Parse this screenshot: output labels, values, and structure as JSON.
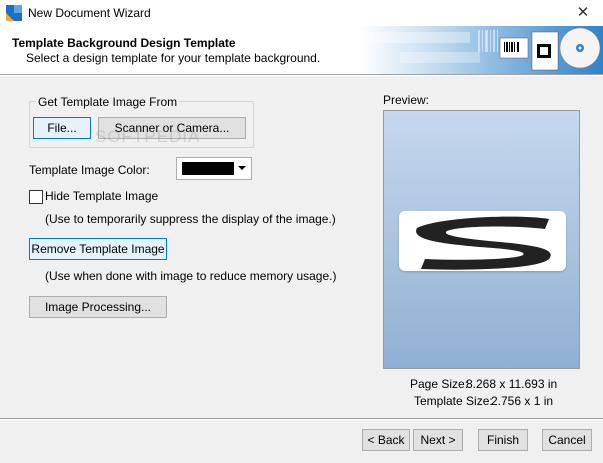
{
  "window": {
    "title": "New Document Wizard",
    "close_glyph": "✕"
  },
  "header": {
    "title": "Template Background Design Template",
    "subtitle": "Select a design template for your template background."
  },
  "left": {
    "group_label": "Get Template Image From",
    "file_button": "File...",
    "scanner_button": "Scanner or Camera...",
    "color_label": "Template Image Color:",
    "color_value": "#000000",
    "hide_label": "Hide Template Image",
    "hide_checked": false,
    "hide_note": "(Use to temporarily suppress the display of the image.)",
    "remove_button": "Remove Template Image",
    "remove_note": "(Use when done with image to reduce memory usage.)",
    "processing_button": "Image Processing..."
  },
  "preview": {
    "label": "Preview:",
    "page_size_label": "Page Size:",
    "page_size_value": "8.268 x 11.693 in",
    "template_size_label": "Template Size:",
    "template_size_value": "2.756 x 1 in"
  },
  "footer": {
    "back": "< Back",
    "next": "Next >",
    "finish": "Finish",
    "cancel": "Cancel"
  },
  "watermark": "SOFTPEDIA",
  "colors": {
    "accent": "#0078d7",
    "preview_top": "#c5d8ee",
    "preview_bottom": "#8fb0d4"
  }
}
